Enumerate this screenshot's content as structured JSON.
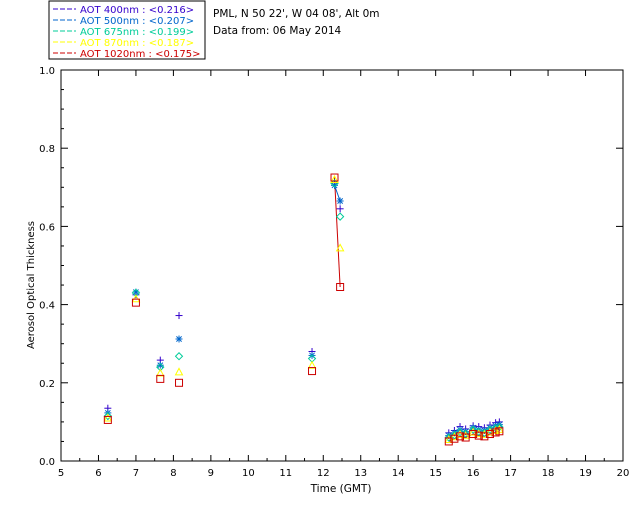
{
  "header": {
    "site_line": "PML, N 50 22', W 04 08', Alt 0m",
    "date_line": "Data from: 06 May 2014"
  },
  "legend": [
    {
      "label": "AOT  400nm : <0.216>",
      "color": "#3300cc"
    },
    {
      "label": "AOT  500nm : <0.207>",
      "color": "#0066cc"
    },
    {
      "label": "AOT  675nm : <0.199>",
      "color": "#00cc99"
    },
    {
      "label": "AOT  870nm : <0.187>",
      "color": "#ffff00"
    },
    {
      "label": "AOT 1020nm : <0.175>",
      "color": "#cc0000"
    }
  ],
  "chart_data": {
    "type": "scatter",
    "xlabel": "Time (GMT)",
    "ylabel": "Aerosol Optical Thickness",
    "xlim": [
      5,
      20
    ],
    "ylim": [
      0.0,
      1.0
    ],
    "xticks": [
      "5",
      "6",
      "7",
      "8",
      "9",
      "10",
      "11",
      "12",
      "13",
      "14",
      "15",
      "16",
      "17",
      "18",
      "19",
      "20"
    ],
    "yticks": [
      "0.0",
      "0.2",
      "0.4",
      "0.6",
      "0.8",
      "1.0"
    ],
    "grid": false,
    "legend_position": "top-left",
    "series": [
      {
        "name": "AOT  400nm : <0.216>",
        "marker": "plus",
        "color": "#3300cc",
        "x": [
          6.25,
          7.0,
          7.65,
          8.15,
          11.7,
          12.3,
          12.45,
          15.35,
          15.5,
          15.65,
          15.8,
          16.0,
          16.15,
          16.3,
          16.45,
          16.6,
          16.7
        ],
        "y": [
          0.135,
          0.425,
          0.258,
          0.372,
          0.28,
          0.712,
          0.645,
          0.072,
          0.078,
          0.088,
          0.082,
          0.09,
          0.088,
          0.085,
          0.092,
          0.098,
          0.1
        ]
      },
      {
        "name": "AOT  500nm : <0.207>",
        "marker": "asterisk",
        "color": "#0066cc",
        "x": [
          6.25,
          7.0,
          7.65,
          8.15,
          11.7,
          12.3,
          12.45,
          15.35,
          15.5,
          15.65,
          15.8,
          16.0,
          16.15,
          16.3,
          16.45,
          16.6,
          16.7
        ],
        "y": [
          0.123,
          0.432,
          0.245,
          0.312,
          0.27,
          0.705,
          0.665,
          0.065,
          0.072,
          0.08,
          0.075,
          0.085,
          0.08,
          0.078,
          0.085,
          0.09,
          0.093
        ]
      },
      {
        "name": "AOT  675nm : <0.199>",
        "marker": "diamond",
        "color": "#00cc99",
        "x": [
          6.25,
          7.0,
          7.65,
          8.15,
          11.7,
          12.3,
          12.45,
          15.35,
          15.5,
          15.65,
          15.8,
          16.0,
          16.15,
          16.3,
          16.45,
          16.6,
          16.7
        ],
        "y": [
          0.115,
          0.43,
          0.24,
          0.268,
          0.262,
          0.71,
          0.625,
          0.06,
          0.066,
          0.074,
          0.07,
          0.08,
          0.075,
          0.072,
          0.08,
          0.084,
          0.087
        ]
      },
      {
        "name": "AOT  870nm : <0.187>",
        "marker": "triangle",
        "color": "#ffff00",
        "x": [
          6.25,
          7.0,
          7.65,
          8.15,
          11.7,
          12.3,
          12.45,
          15.35,
          15.5,
          15.65,
          15.8,
          16.0,
          16.15,
          16.3,
          16.45,
          16.6,
          16.7
        ],
        "y": [
          0.11,
          0.415,
          0.225,
          0.228,
          0.245,
          0.72,
          0.545,
          0.055,
          0.062,
          0.068,
          0.065,
          0.074,
          0.07,
          0.068,
          0.074,
          0.078,
          0.081
        ]
      },
      {
        "name": "AOT 1020nm : <0.175>",
        "marker": "square",
        "color": "#cc0000",
        "x": [
          6.25,
          7.0,
          7.65,
          8.15,
          11.7,
          12.3,
          12.45,
          15.35,
          15.5,
          15.65,
          15.8,
          16.0,
          16.15,
          16.3,
          16.45,
          16.6,
          16.7
        ],
        "y": [
          0.105,
          0.405,
          0.21,
          0.2,
          0.23,
          0.725,
          0.445,
          0.05,
          0.057,
          0.063,
          0.06,
          0.069,
          0.065,
          0.063,
          0.069,
          0.073,
          0.076
        ]
      }
    ]
  }
}
